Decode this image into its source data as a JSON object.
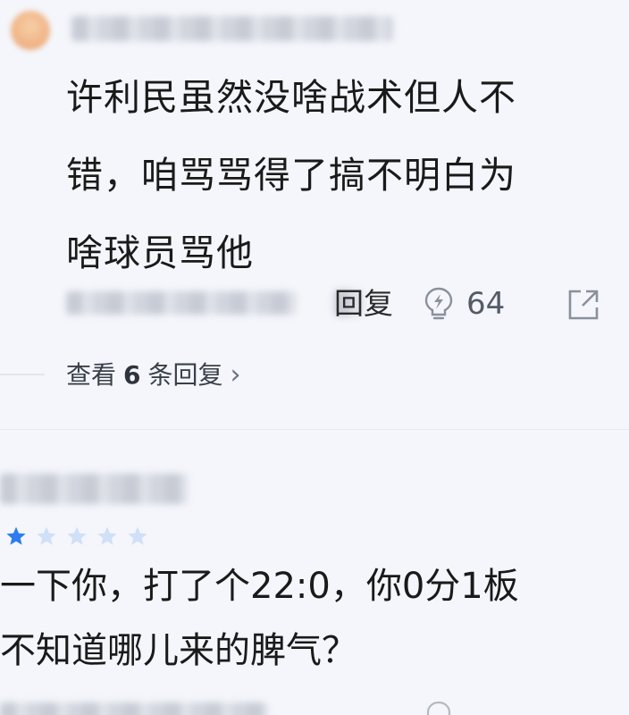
{
  "comment1": {
    "text_line1": "许利民虽然没啥战术但人不",
    "text_line2": "错，咱骂骂得了搞不明白为",
    "text_line3": "啥球员骂他",
    "reply_label": "回复",
    "likes": "64",
    "view_replies_prefix": "查看",
    "view_replies_count": "6",
    "view_replies_suffix": "条回复",
    "chevron": "›"
  },
  "comment2": {
    "rating": 1,
    "rating_max": 5,
    "text_line1": "一下你，打了个22:0，你0分1板",
    "text_line2": "不知道哪儿来的脾气？"
  },
  "colors": {
    "star_active": "#2d7df0",
    "star_inactive": "#cfe0f7",
    "icon_gray": "#8a909c"
  },
  "icons": {
    "like": "lightning-like-icon",
    "share": "share-icon",
    "chevron": "chevron-right-icon",
    "star": "star-icon"
  }
}
